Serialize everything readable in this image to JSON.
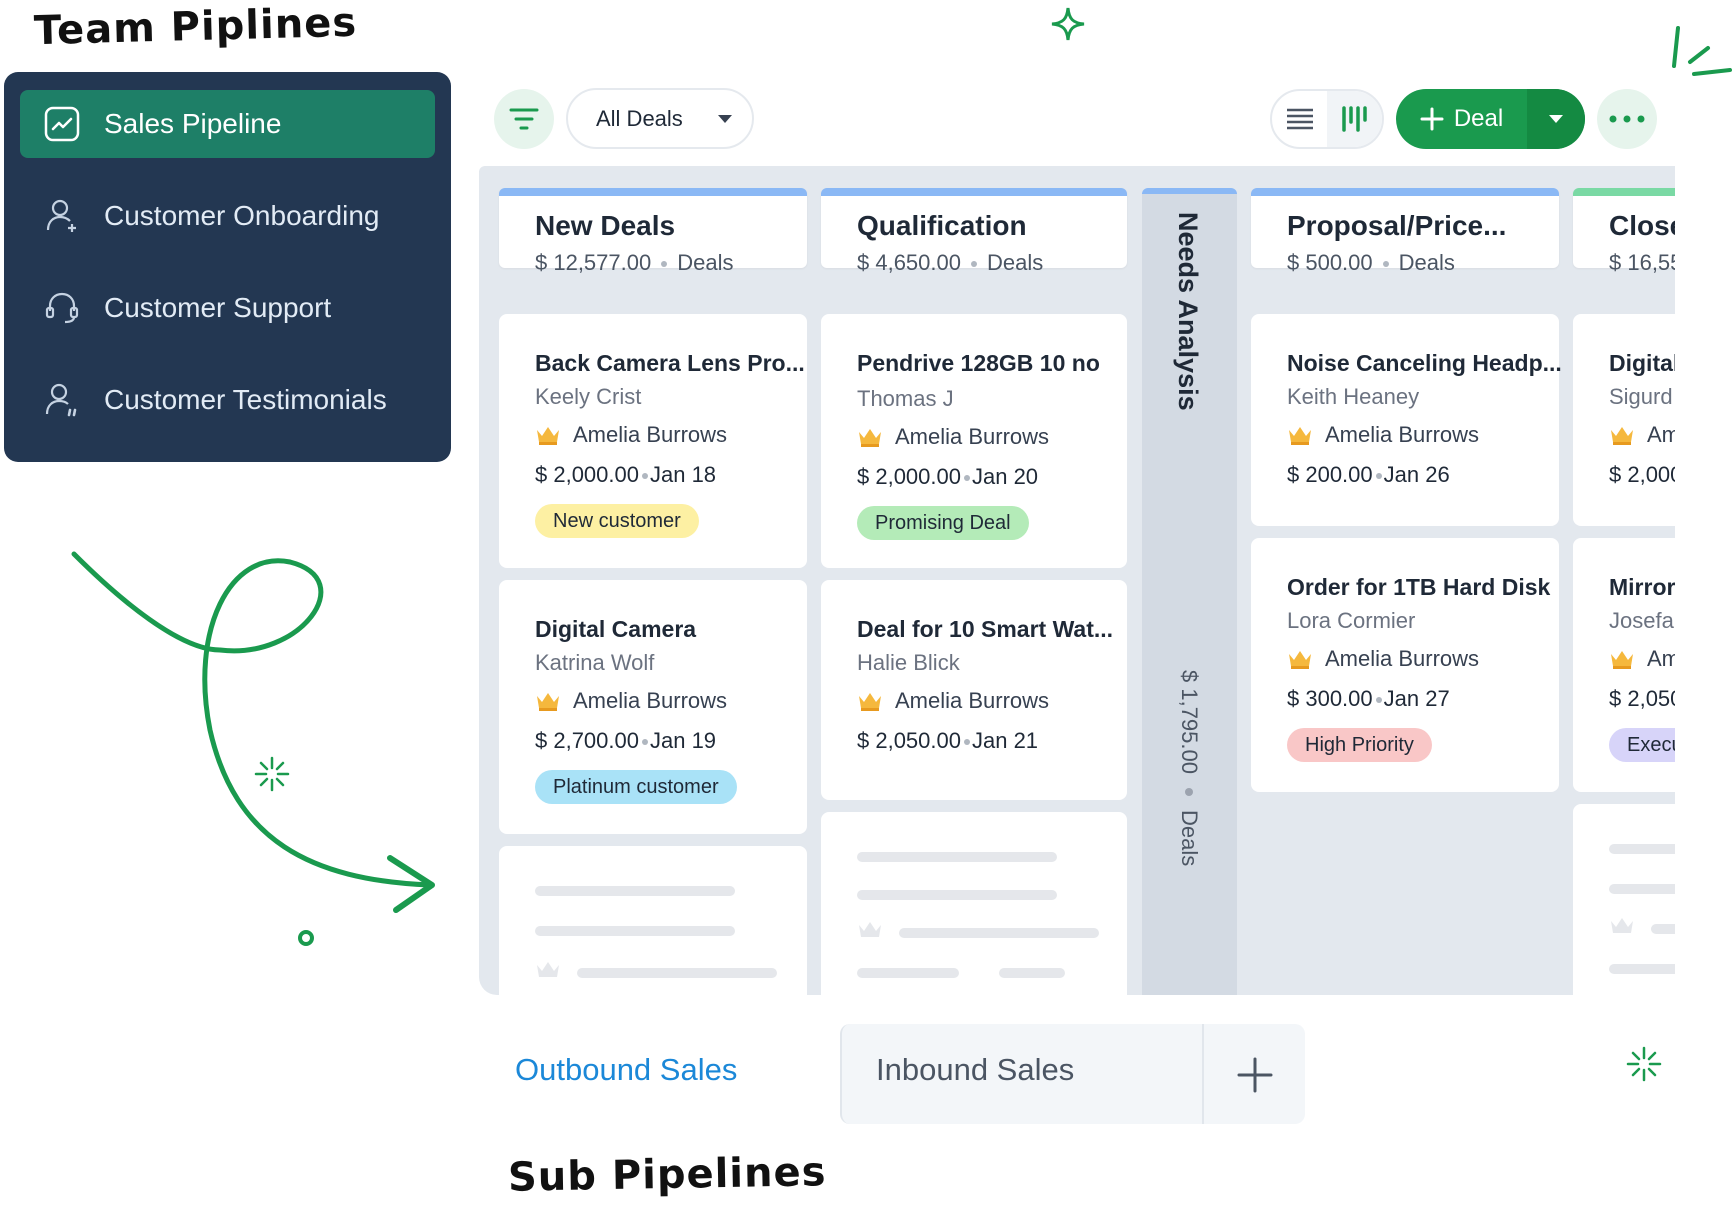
{
  "team": {
    "title": "Team Piplines",
    "items": [
      {
        "label": "Sales Pipeline",
        "icon": "chart-trend-icon",
        "active": true
      },
      {
        "label": "Customer Onboarding",
        "icon": "user-add-icon"
      },
      {
        "label": "Customer Support",
        "icon": "headset-icon"
      },
      {
        "label": "Customer Testimonials",
        "icon": "user-quote-icon"
      }
    ]
  },
  "toolbar": {
    "filter_icon": "filter-icon",
    "view_select": "All Deals",
    "deal_button": "Deal",
    "more_icon": "more-dots-icon"
  },
  "columns": [
    {
      "name": "New Deals",
      "amount": "$ 12,577.00",
      "count_label": "Deals"
    },
    {
      "name": "Qualification",
      "amount": "$ 4,650.00",
      "count_label": "Deals"
    },
    {
      "name": "Needs Analysis",
      "amount": "$ 1,795.00",
      "count_label": "Deals"
    },
    {
      "name": "Proposal/Price...",
      "amount": "$ 500.00",
      "count_label": "Deals"
    },
    {
      "name": "Close",
      "amount": "$ 16,55"
    }
  ],
  "cards": {
    "c1": {
      "title": "Back Camera Lens Pro...",
      "contact": "Keely Crist",
      "owner": "Amelia Burrows",
      "amount": "$ 2,000.00",
      "date": "Jan 18",
      "tag": "New customer"
    },
    "c2": {
      "title": "Digital Camera",
      "contact": "Katrina Wolf",
      "owner": "Amelia Burrows",
      "amount": "$ 2,700.00",
      "date": "Jan 19",
      "tag": "Platinum customer"
    },
    "c3": {
      "title": "Pendrive 128GB 10 no",
      "contact": "Thomas J",
      "owner": "Amelia Burrows",
      "amount": "$ 2,000.00",
      "date": "Jan 20",
      "tag": "Promising Deal"
    },
    "c4": {
      "title": "Deal for 10 Smart Wat...",
      "contact": "Halie Blick",
      "owner": "Amelia Burrows",
      "amount": "$ 2,050.00",
      "date": "Jan 21"
    },
    "c5": {
      "title": "Noise Canceling Headp...",
      "contact": "Keith Heaney",
      "owner": "Amelia Burrows",
      "amount": "$ 200.00",
      "date": "Jan 26"
    },
    "c6": {
      "title": "Order for 1TB Hard Disk",
      "contact": "Lora Cormier",
      "owner": "Amelia Burrows",
      "amount": "$ 300.00",
      "date": "Jan 27",
      "tag": "High Priority"
    },
    "c7": {
      "title": "Digital",
      "contact": "Sigurd \\",
      "owner": "Am",
      "amount": "$ 2,000"
    },
    "c8": {
      "title": "Mirrorl",
      "contact": "Josefa I",
      "owner": "Am",
      "amount": "$ 2,050",
      "tag": "Execu"
    }
  },
  "sub": {
    "tabs": [
      "Outbound Sales",
      "Inbound Sales"
    ],
    "add_icon": "plus-icon",
    "title": "Sub Pipelines"
  },
  "colors": {
    "brand": "#1a9a4e",
    "panel": "#233752",
    "active_item": "#1e7f67",
    "link": "#1b88d8",
    "tag_new": "#fdf0a3",
    "tag_platinum": "#a9e2f7",
    "tag_promising": "#b4ebb8",
    "tag_high": "#f9c7c7",
    "tag_exec": "#d7d4f9"
  }
}
